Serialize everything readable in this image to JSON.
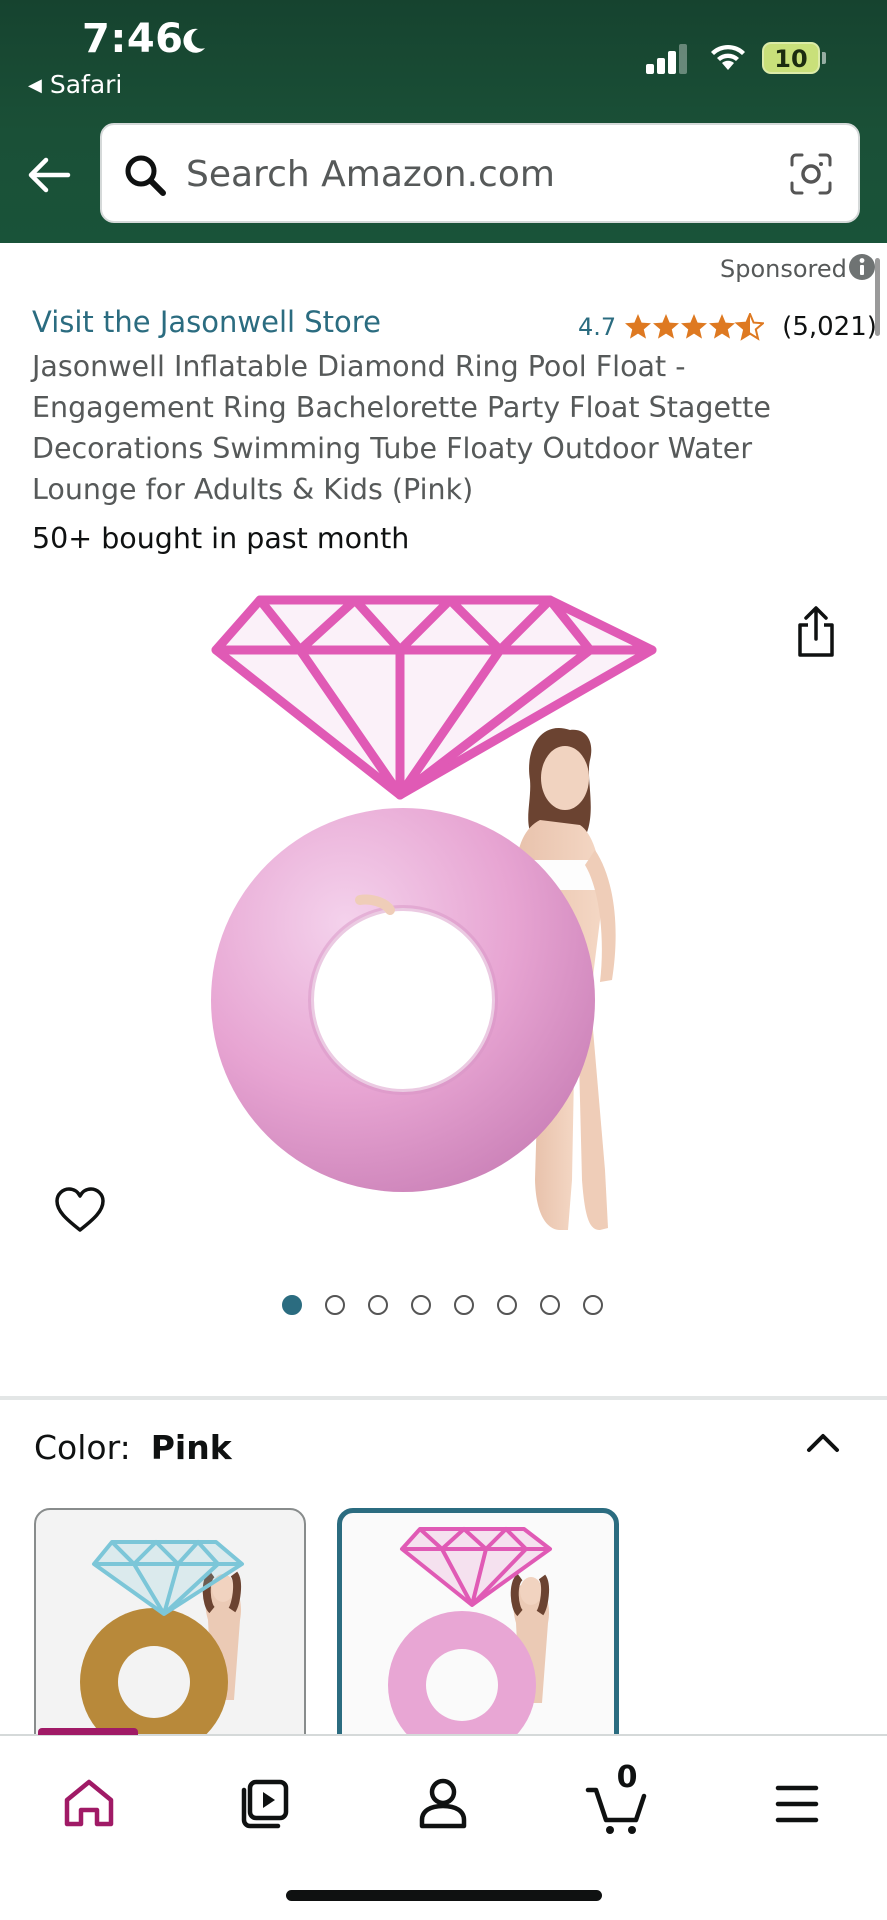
{
  "status_bar": {
    "time": "7:46",
    "back_app": "Safari",
    "battery_level": "10"
  },
  "search": {
    "placeholder": "Search Amazon.com"
  },
  "product": {
    "sponsored_label": "Sponsored",
    "store_link": "Visit the Jasonwell Store",
    "rating_value": "4.7",
    "rating_stars": 4.7,
    "rating_count": "(5,021)",
    "title": "Jasonwell Inflatable Diamond Ring Pool Float - Engagement Ring Bachelorette Party Float Stagette Decorations Swimming Tube Floaty Outdoor Water Lounge for Adults & Kids (Pink)",
    "bought_text": "50+ bought in past month",
    "image_count": 8,
    "active_image": 1
  },
  "color_selector": {
    "label": "Color:",
    "selected": "Pink",
    "options": [
      {
        "name": "Gold",
        "ring_color": "#b8893a",
        "diamond_color": "#7cc6d8"
      },
      {
        "name": "Pink",
        "ring_color": "#e8a6d4",
        "diamond_color": "#e05ab5"
      }
    ]
  },
  "bottom_nav": {
    "items": [
      "home-icon",
      "video-icon",
      "account-icon",
      "cart-icon",
      "menu-icon"
    ],
    "active": "home",
    "cart_count": "0"
  },
  "colors": {
    "header_green": "#1a5037",
    "link_teal": "#2b6c80",
    "star_orange": "#de7921",
    "nav_active": "#a01a66"
  }
}
